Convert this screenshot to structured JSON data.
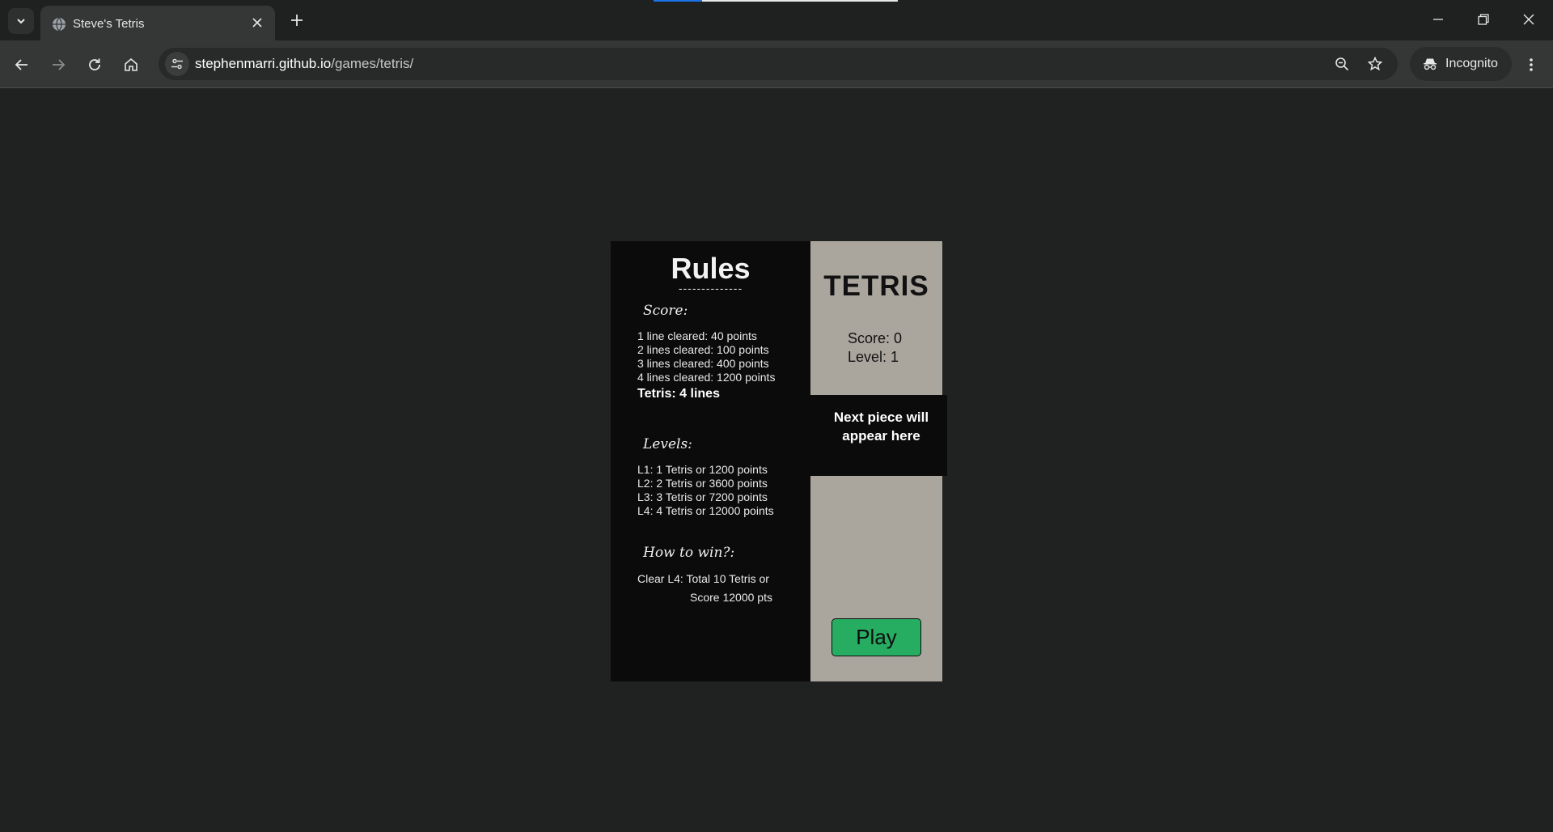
{
  "browser": {
    "tab_title": "Steve's Tetris",
    "url_host": "stephenmarri.github.io",
    "url_path": "/games/tetris/",
    "profile_label": "Incognito",
    "icons": {
      "tab_search": "chevron-down-icon",
      "favicon": "globe-icon",
      "tab_close": "close-icon",
      "new_tab": "plus-icon",
      "back": "arrow-left-icon",
      "forward": "arrow-right-icon",
      "reload": "reload-icon",
      "home": "home-icon",
      "site_info": "tune-icon",
      "zoom": "zoom-out-icon",
      "bookmark": "star-icon",
      "incognito": "incognito-icon",
      "menu": "kebab-menu-icon",
      "minimize": "minimize-icon",
      "restore": "restore-icon",
      "close_window": "close-icon"
    }
  },
  "rules": {
    "title": "Rules",
    "divider": "--------------",
    "score_heading": "Score:",
    "score_lines": [
      "1 line  cleared:   40 points",
      "2 lines cleared:   100 points",
      "3 lines cleared:   400 points",
      "4 lines cleared:   1200 points"
    ],
    "tetris_definition": "Tetris:  4 lines",
    "levels_heading": "Levels:",
    "level_lines": [
      "L1: 1 Tetris or 1200 points",
      "L2: 2 Tetris or 3600 points",
      "L3: 3 Tetris or 7200 points",
      "L4: 4 Tetris or 12000 points"
    ],
    "win_heading": "How to win?:",
    "win_line1": "Clear L4: Total 10 Tetris or",
    "win_line2": "Score 12000 pts"
  },
  "panel": {
    "title": "TETRIS",
    "score_label": "Score: 0",
    "level_label": "Level: 1",
    "next_piece_line1": "Next piece will",
    "next_piece_line2": "appear here",
    "play_label": "Play"
  },
  "colors": {
    "page_bg": "#202222",
    "rules_bg": "#0b0b0c",
    "panel_bg": "#aba69d",
    "play_button": "#27ad62"
  }
}
